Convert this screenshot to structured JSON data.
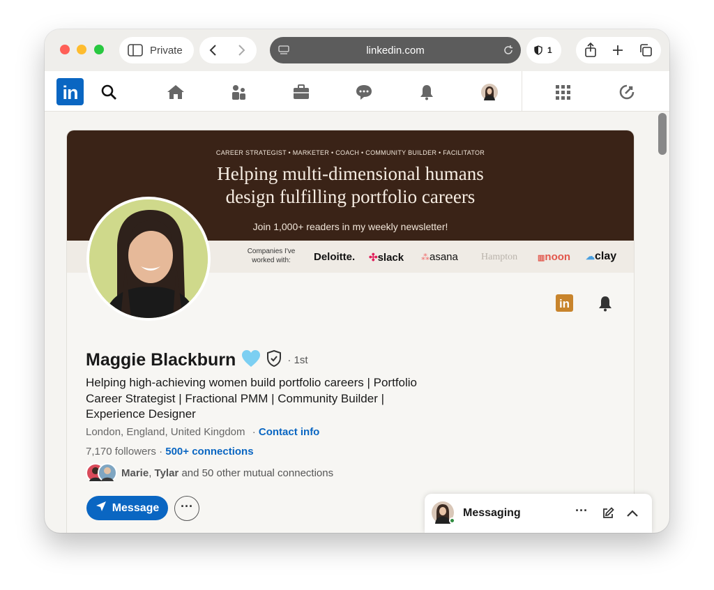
{
  "browser": {
    "private_label": "Private",
    "url": "linkedin.com",
    "shield_count": "1",
    "colors": {
      "close": "#ff5f57",
      "minimize": "#febc2e",
      "maximize": "#28c840"
    }
  },
  "nav": {
    "logo_text": "in",
    "brand_color": "#0a66c2",
    "icons": [
      "search-icon",
      "home-icon",
      "network-icon",
      "jobs-icon",
      "messaging-icon",
      "notifications-icon",
      "me-avatar",
      "apps-grid-icon",
      "premium-icon"
    ]
  },
  "banner": {
    "tagline": "CAREER STRATEGIST • MARKETER • COACH • COMMUNITY BUILDER • FACILITATOR",
    "headline_line1": "Helping multi-dimensional humans",
    "headline_line2": "design fulfilling portfolio careers",
    "newsletter": "Join 1,000+ readers in my weekly newsletter!",
    "companies_label_1": "Companies I've",
    "companies_label_2": "worked with:",
    "companies": [
      "Deloitte.",
      "slack",
      "asana",
      "Hampton",
      "noon",
      "clay"
    ]
  },
  "profile": {
    "name": "Maggie Blackburn",
    "heart_emoji": "🩵",
    "degree": "· 1st",
    "headline": "Helping high-achieving women build portfolio careers | Portfolio Career Strategist | Fractional PMM | Community Builder | Experience Designer",
    "location": "London, England, United Kingdom",
    "contact_sep": "·",
    "contact_info": "Contact info",
    "followers": "7,170 followers",
    "dot_sep": "·",
    "connections": "500+ connections",
    "mutual_name1": "Marie",
    "mutual_sep": ",",
    "mutual_name2": "Tylar",
    "mutual_rest": "and 50 other mutual connections",
    "message_label": "Message",
    "more_label": "···"
  },
  "messaging": {
    "label": "Messaging",
    "more": "···"
  }
}
